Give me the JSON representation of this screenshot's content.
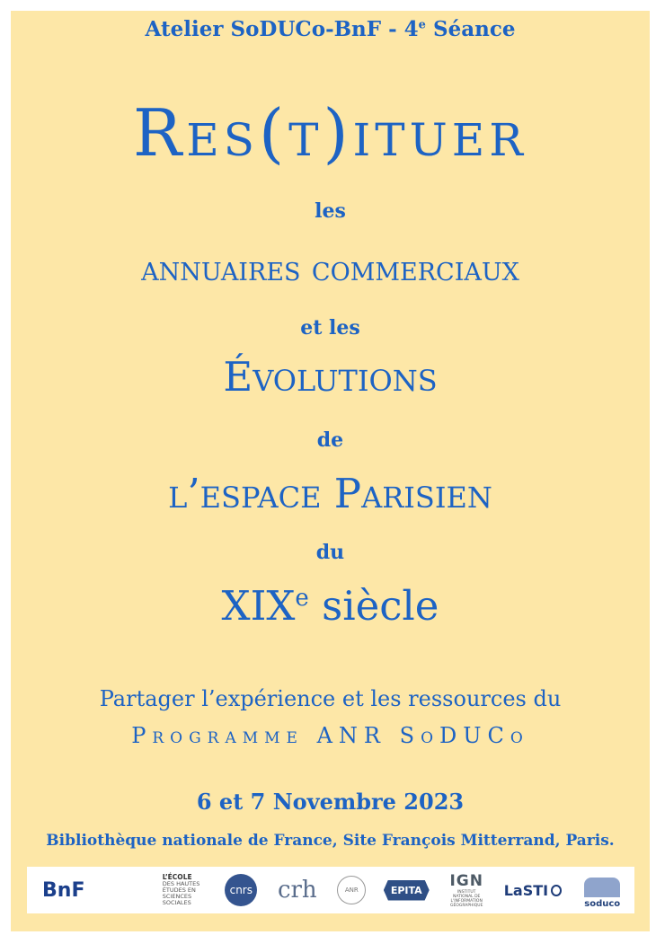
{
  "header": {
    "text": "Atelier SoDUCo-BnF - 4",
    "sup": "e",
    "tail": " Séance"
  },
  "title": {
    "main": "Res(t)ituer"
  },
  "lines": {
    "les": "les",
    "annuaires": "annuaires commerciaux",
    "et_les": "et les",
    "evolutions": "Évolutions",
    "de": "de",
    "espace": "l’espace Parisien",
    "du": "du",
    "siecle_main": "XIX",
    "siecle_sup": "e",
    "siecle_tail": " siècle"
  },
  "subtitle": {
    "line1": "Partager l’expérience et les ressources du",
    "line2": "Programme ANR SoDUCo"
  },
  "event": {
    "date": "6 et 7 Novembre 2023",
    "place": "Bibliothèque nationale de France, Site François Mitterrand, Paris."
  },
  "colors": {
    "text": "#1d63c4",
    "background": "#fde7a7"
  },
  "logos": {
    "bnf": "BnF",
    "ehess_title": "L’ÉCOLE",
    "ehess_sub": "DES HAUTES ÉTUDES EN SCIENCES SOCIALES",
    "cnrs": "cnrs",
    "crh": "crh",
    "anr": "ANR",
    "epita": "EPITA",
    "ign": "IGN",
    "lasti": "LaSTI",
    "soduco": "soduco"
  }
}
